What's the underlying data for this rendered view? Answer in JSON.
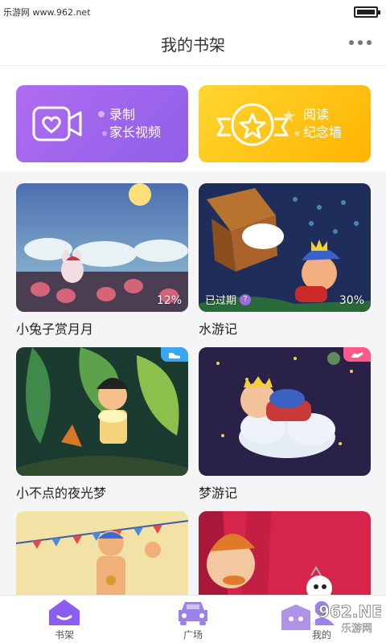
{
  "status_bar": {
    "site": "乐游网 www.962.net"
  },
  "header": {
    "title": "我的书架"
  },
  "banners": [
    {
      "line1": "录制",
      "line2": "家长视频",
      "icon": "video-heart-icon",
      "color": "#9a63ec"
    },
    {
      "line1": "阅读",
      "line2": "纪念墙",
      "icon": "star-badge-icon",
      "color": "#ffc71a"
    }
  ],
  "books": [
    {
      "title": "小兔子赏月月",
      "progress": "12%"
    },
    {
      "title": "水游记",
      "progress": "30%",
      "status": "已过期",
      "status_icon": "?"
    },
    {
      "title": "小不点的夜光梦",
      "tag_icon": "shoe-icon",
      "tag_color": "#3aa8f0"
    },
    {
      "title": "梦游记",
      "tag_icon": "shoe-icon",
      "tag_color": "#ff5a8a"
    },
    {
      "title": ""
    },
    {
      "title": ""
    }
  ],
  "tabs": [
    {
      "label": "书架",
      "icon": "house-icon",
      "active": true
    },
    {
      "label": "广场",
      "icon": "car-icon"
    },
    {
      "label": "我的",
      "icon": "user-icon"
    }
  ],
  "watermark": {
    "text": "962.NET",
    "sub": "乐游网"
  },
  "colors": {
    "accent": "#8d5cf0",
    "banner_purple": "#9a63ec",
    "banner_yellow": "#ffc71a"
  }
}
